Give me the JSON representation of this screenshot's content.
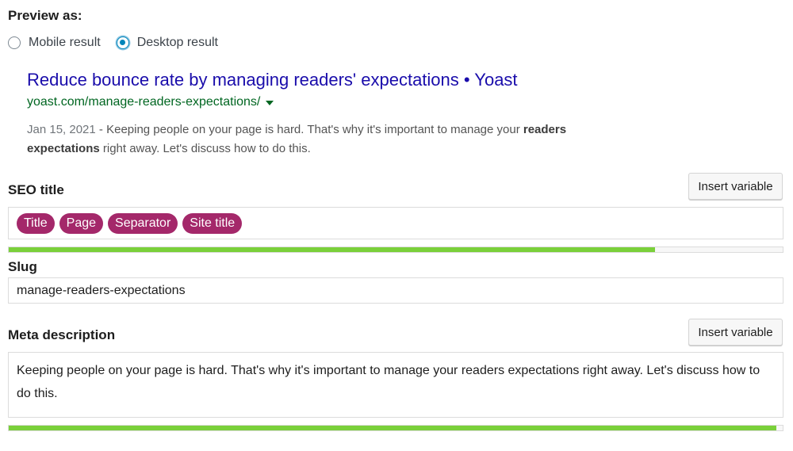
{
  "preview": {
    "label": "Preview as:",
    "options": [
      {
        "label": "Mobile result",
        "selected": false
      },
      {
        "label": "Desktop result",
        "selected": true
      }
    ]
  },
  "serp": {
    "title": "Reduce bounce rate by managing readers' expectations • Yoast",
    "url": "yoast.com/manage-readers-expectations/",
    "date": "Jan 15, 2021",
    "separator": " - ",
    "desc_part1": "Keeping people on your page is hard. That's why it's important to manage your ",
    "desc_bold": "readers expectations",
    "desc_part2": " right away. Let's discuss how to do this.",
    "title_color": "#1a0dab",
    "url_color": "#006621"
  },
  "seo_title": {
    "label": "SEO title",
    "insert_button": "Insert variable",
    "pills": [
      "Title",
      "Page",
      "Separator",
      "Site title"
    ],
    "pill_color": "#a4286a",
    "progress": 0.835,
    "progress_color": "#7ad03a"
  },
  "slug": {
    "label": "Slug",
    "value": "manage-readers-expectations"
  },
  "meta": {
    "label": "Meta description",
    "insert_button": "Insert variable",
    "value": "Keeping people on your page is hard. That's why it's important to manage your readers expectations right away. Let's discuss how to do this.",
    "progress": 0.992,
    "progress_color": "#7ad03a"
  }
}
